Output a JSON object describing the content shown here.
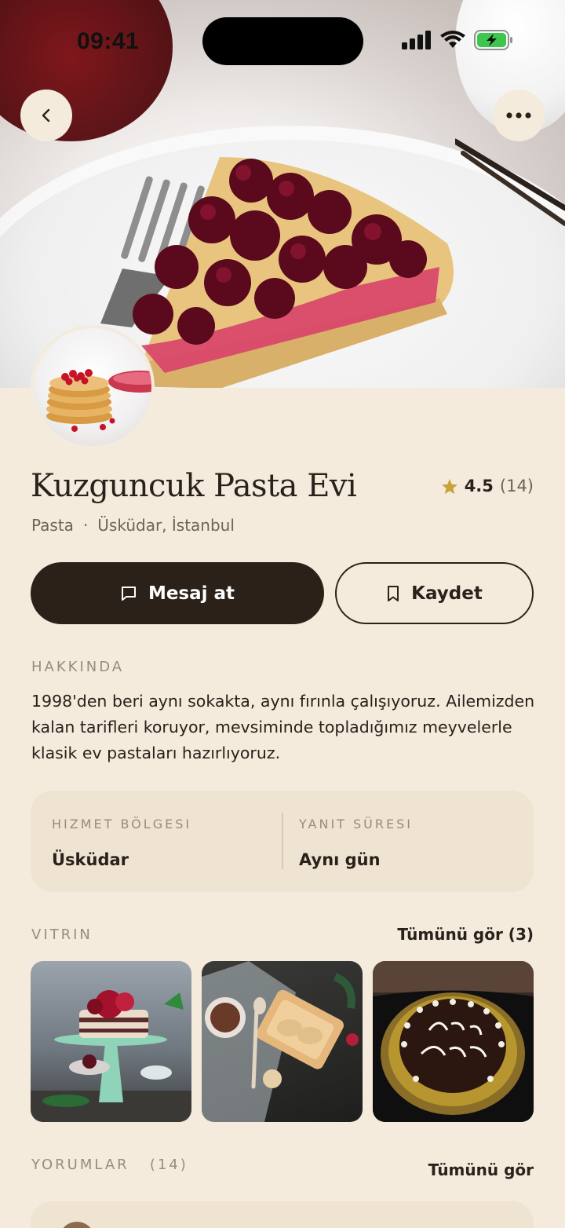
{
  "status_bar": {
    "time": "09:41"
  },
  "profile": {
    "name": "Kuzguncuk Pasta Evi",
    "rating": "4.5",
    "rating_count": "(14)",
    "category": "Pasta",
    "separator": "·",
    "location": "Üsküdar, İstanbul"
  },
  "actions": {
    "message_label": "Mesaj at",
    "save_label": "Kaydet"
  },
  "about": {
    "label": "HAKKINDA",
    "text": "1998'den beri aynı sokakta, aynı fırınla çalışıyoruz. Ailemizden kalan tarifleri koruyor, mevsiminde topladığımız meyvelerle klasik ev pastaları hazırlıyoruz."
  },
  "info": {
    "service_area_label": "HIZMET BÖLGESI",
    "service_area_value": "Üsküdar",
    "response_time_label": "YANIT SÜRESI",
    "response_time_value": "Aynı gün"
  },
  "showcase": {
    "label": "VITRIN",
    "see_all": "Tümünü gör (3)"
  },
  "reviews": {
    "label": "YORUMLAR",
    "count": "(14)",
    "see_all": "Tümünü gör"
  },
  "icons": {
    "back": "chevron-left-icon",
    "more": "more-horizontal-icon",
    "star": "star-icon",
    "message": "message-icon",
    "bookmark": "bookmark-icon"
  },
  "colors": {
    "dark": "#2c2119",
    "background": "#f4ebdd",
    "card": "#efe3d2",
    "star": "#c9a23a",
    "muted": "#9b8b7c"
  }
}
